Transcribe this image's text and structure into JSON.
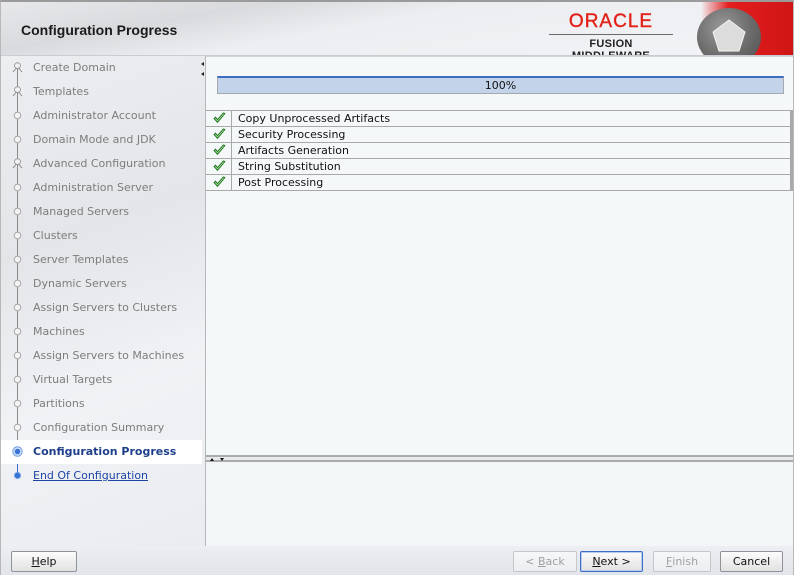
{
  "header": {
    "title": "Configuration Progress",
    "brand": {
      "name": "ORACLE",
      "product": "FUSION MIDDLEWARE",
      "accent_color": "#e2231a"
    }
  },
  "sidebar": {
    "items": [
      {
        "label": "Create Domain",
        "state": "done",
        "node": "branch"
      },
      {
        "label": "Templates",
        "state": "done",
        "node": "branch"
      },
      {
        "label": "Administrator Account",
        "state": "done",
        "node": "circle"
      },
      {
        "label": "Domain Mode and JDK",
        "state": "done",
        "node": "circle"
      },
      {
        "label": "Advanced Configuration",
        "state": "done",
        "node": "branch"
      },
      {
        "label": "Administration Server",
        "state": "done",
        "node": "circle"
      },
      {
        "label": "Managed Servers",
        "state": "done",
        "node": "circle"
      },
      {
        "label": "Clusters",
        "state": "done",
        "node": "circle"
      },
      {
        "label": "Server Templates",
        "state": "done",
        "node": "circle"
      },
      {
        "label": "Dynamic Servers",
        "state": "done",
        "node": "circle"
      },
      {
        "label": "Assign Servers to Clusters",
        "state": "done",
        "node": "circle"
      },
      {
        "label": "Machines",
        "state": "done",
        "node": "circle"
      },
      {
        "label": "Assign Servers to Machines",
        "state": "done",
        "node": "circle"
      },
      {
        "label": "Virtual Targets",
        "state": "done",
        "node": "circle"
      },
      {
        "label": "Partitions",
        "state": "done",
        "node": "circle"
      },
      {
        "label": "Configuration Summary",
        "state": "done",
        "node": "circle"
      },
      {
        "label": "Configuration Progress",
        "state": "current",
        "node": "current"
      },
      {
        "label": "End Of Configuration",
        "state": "link",
        "node": "dot"
      }
    ]
  },
  "main": {
    "progress": {
      "value_percent": 100,
      "label": "100%"
    },
    "tasks": [
      {
        "label": "Copy Unprocessed Artifacts",
        "status": "complete",
        "icon": "check-icon"
      },
      {
        "label": "Security Processing",
        "status": "complete",
        "icon": "check-icon"
      },
      {
        "label": "Artifacts Generation",
        "status": "complete",
        "icon": "check-icon"
      },
      {
        "label": "String Substitution",
        "status": "complete",
        "icon": "check-icon"
      },
      {
        "label": "Post Processing",
        "status": "complete",
        "icon": "check-icon"
      }
    ],
    "log_text": ""
  },
  "footer": {
    "help": {
      "label": "Help",
      "mnemonic": "H",
      "rest": "elp",
      "enabled": true
    },
    "back": {
      "prefix": "< ",
      "mnemonic": "B",
      "rest": "ack",
      "enabled": false
    },
    "next": {
      "mnemonic": "N",
      "rest": "ext >",
      "enabled": true
    },
    "finish": {
      "mnemonic": "F",
      "rest": "inish",
      "enabled": false
    },
    "cancel": {
      "label": "Cancel",
      "enabled": true
    }
  }
}
